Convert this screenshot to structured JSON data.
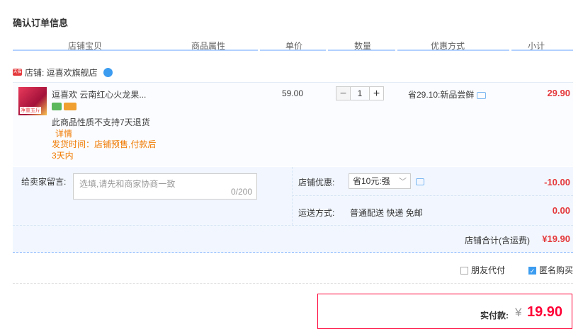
{
  "page_title": "确认订单信息",
  "columns": [
    "店铺宝贝",
    "商品属性",
    "单价",
    "数量",
    "优惠方式",
    "小计"
  ],
  "shop": {
    "label": "店铺: 逗喜欢旗舰店",
    "icon": "tmall-icon"
  },
  "item": {
    "thumb_label": "净重五斤",
    "title": "逗喜欢 云南红心火龙果...",
    "note": "此商品性质不支持7天退货",
    "detail_link": "详情",
    "ship_time": "发货时间：店铺预售,付款后3天内",
    "price": "59.00",
    "quantity": "1",
    "minus": "−",
    "plus": "+",
    "promo": "省29.10:新品尝鲜",
    "subtotal": "29.90"
  },
  "message": {
    "label": "给卖家留言:",
    "placeholder": "选填,请先和商家协商一致",
    "count": "0/200"
  },
  "discount": {
    "label": "店铺优惠:",
    "selected": "省10元:强",
    "value": "-10.00"
  },
  "shipping": {
    "label": "运送方式:",
    "method": "普通配送 快递 免邮",
    "cost": "0.00"
  },
  "shop_total": {
    "label": "店铺合计(含运费)",
    "value": "¥19.90"
  },
  "options": {
    "friend_pay": "朋友代付",
    "anonymous": "匿名购买",
    "anonymous_checked": true
  },
  "payment": {
    "label": "实付款:",
    "currency": "¥",
    "value": "19.90"
  },
  "colors": {
    "accent": "#e4393c",
    "pay_red": "#ff0036",
    "header_line": "#b2d1ff",
    "panel_bg": "#f2f7ff"
  }
}
